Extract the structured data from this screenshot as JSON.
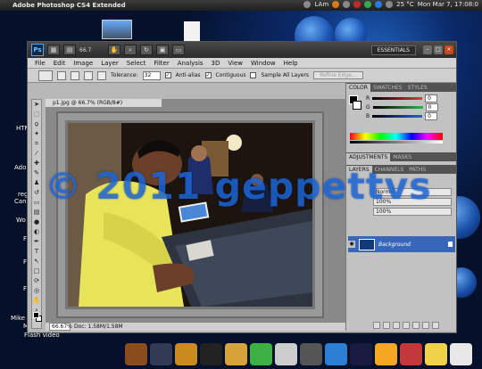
{
  "topbar": {
    "app_title": "Adobe Photoshop CS4 Extended",
    "network": "LAm",
    "temperature": "25 °C",
    "clock": "Mon Mar 7, 17:08:0"
  },
  "desktop": {
    "labels": [
      "HTM",
      "Ado",
      "reg",
      "Can",
      "Wo",
      "F",
      "F",
      "F",
      "Mike",
      "M"
    ],
    "flash_label": "Flash video",
    "dock_colors": [
      "#8a4b1d",
      "#333a55",
      "#c98a1e",
      "#222222",
      "#d6a23a",
      "#3cb045",
      "#cccccc",
      "#555555",
      "#2d7fd6",
      "#1a1a40",
      "#f5a623",
      "#c33838",
      "#f0d24a",
      "#e8e8e8"
    ]
  },
  "ps": {
    "logo": "Ps",
    "zoom": "66.7",
    "essentials": "ESSENTIALS",
    "menu": [
      "File",
      "Edit",
      "Image",
      "Layer",
      "Select",
      "Filter",
      "Analysis",
      "3D",
      "View",
      "Window",
      "Help"
    ],
    "options": {
      "tolerance_label": "Tolerance:",
      "tolerance_value": "32",
      "antialias": "Anti-alias",
      "contiguous": "Contiguous",
      "sample_all": "Sample All Layers",
      "refine": "Refine Edge..."
    },
    "document_tab": "p1.jpg @ 66.7% (RGB/8#)",
    "status": {
      "zoom": "66.67%",
      "doc": "Doc: 1.58M/1.58M"
    },
    "panels": {
      "color_tabs": [
        "COLOR",
        "SWATCHES",
        "STYLES"
      ],
      "channels": [
        {
          "label": "R",
          "value": "0",
          "color": "#e23a3a"
        },
        {
          "label": "G",
          "value": "0",
          "color": "#2fb64a"
        },
        {
          "label": "B",
          "value": "0",
          "color": "#2b5fe0"
        }
      ],
      "adjust_tabs": [
        "ADJUSTMENTS",
        "MASKS"
      ],
      "layer_tabs": [
        "LAYERS",
        "CHANNELS",
        "PATHS"
      ],
      "blend": "Normal",
      "opacity": "100%",
      "fill": "100%",
      "layer_name": "Background"
    }
  },
  "watermark": "© 2011 geppettvs"
}
